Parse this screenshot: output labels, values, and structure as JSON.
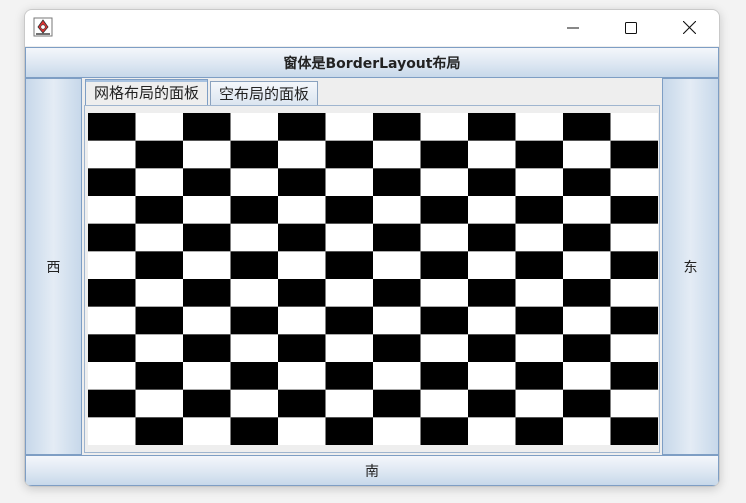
{
  "window": {
    "app_icon": "java-duke-icon",
    "controls": [
      "minimize-icon",
      "maximize-icon",
      "close-icon"
    ]
  },
  "north": {
    "label": "窗体是BorderLayout布局"
  },
  "south": {
    "label": "南"
  },
  "west": {
    "label": "西"
  },
  "east": {
    "label": "东"
  },
  "tabs": [
    {
      "label": "网格布局的面板",
      "selected": true
    },
    {
      "label": "空布局的面板",
      "selected": false
    }
  ],
  "board": {
    "rows": 12,
    "columns": 12,
    "first_cell_color": "#000000",
    "dark_color": "#000000",
    "light_color": "#ffffff"
  }
}
